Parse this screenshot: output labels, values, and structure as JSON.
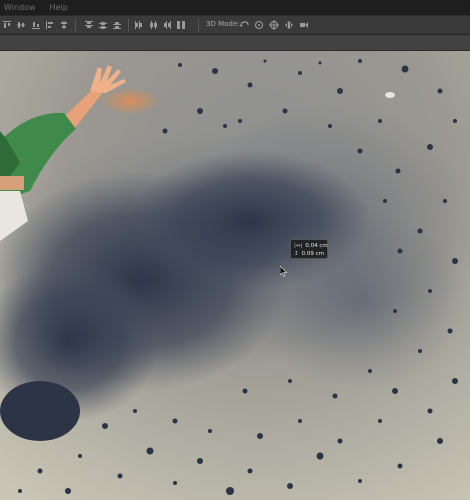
{
  "menu": {
    "items": [
      "Window",
      "Help"
    ]
  },
  "options_bar": {
    "mode_3d_label": "3D Mode:",
    "align_icons": [
      "align-top-icon",
      "align-vcenter-icon",
      "align-bottom-icon",
      "align-left-icon",
      "align-hcenter-icon",
      "align-right-icon"
    ],
    "distribute_icons": [
      "distribute-top-icon",
      "distribute-vcenter-icon",
      "distribute-bottom-icon",
      "distribute-left-icon",
      "distribute-hcenter-icon",
      "distribute-right-icon"
    ],
    "mode_3d_icons": [
      "rotate-3d-icon",
      "roll-3d-icon",
      "drag-3d-icon",
      "slide-3d-icon",
      "scale-3d-icon"
    ]
  },
  "readout": {
    "width_label": "|↔|",
    "width_value": "0.04 cm",
    "height_label": "↕",
    "height_value": "0.09 cm"
  },
  "colors": {
    "menubar": "#1e1e1e",
    "optionsbar": "#3a3a3a",
    "shirt": "#3f8a4a",
    "skin": "#e8a27a",
    "sky": "#a9a9a3",
    "dispersion": "#3b4356"
  }
}
